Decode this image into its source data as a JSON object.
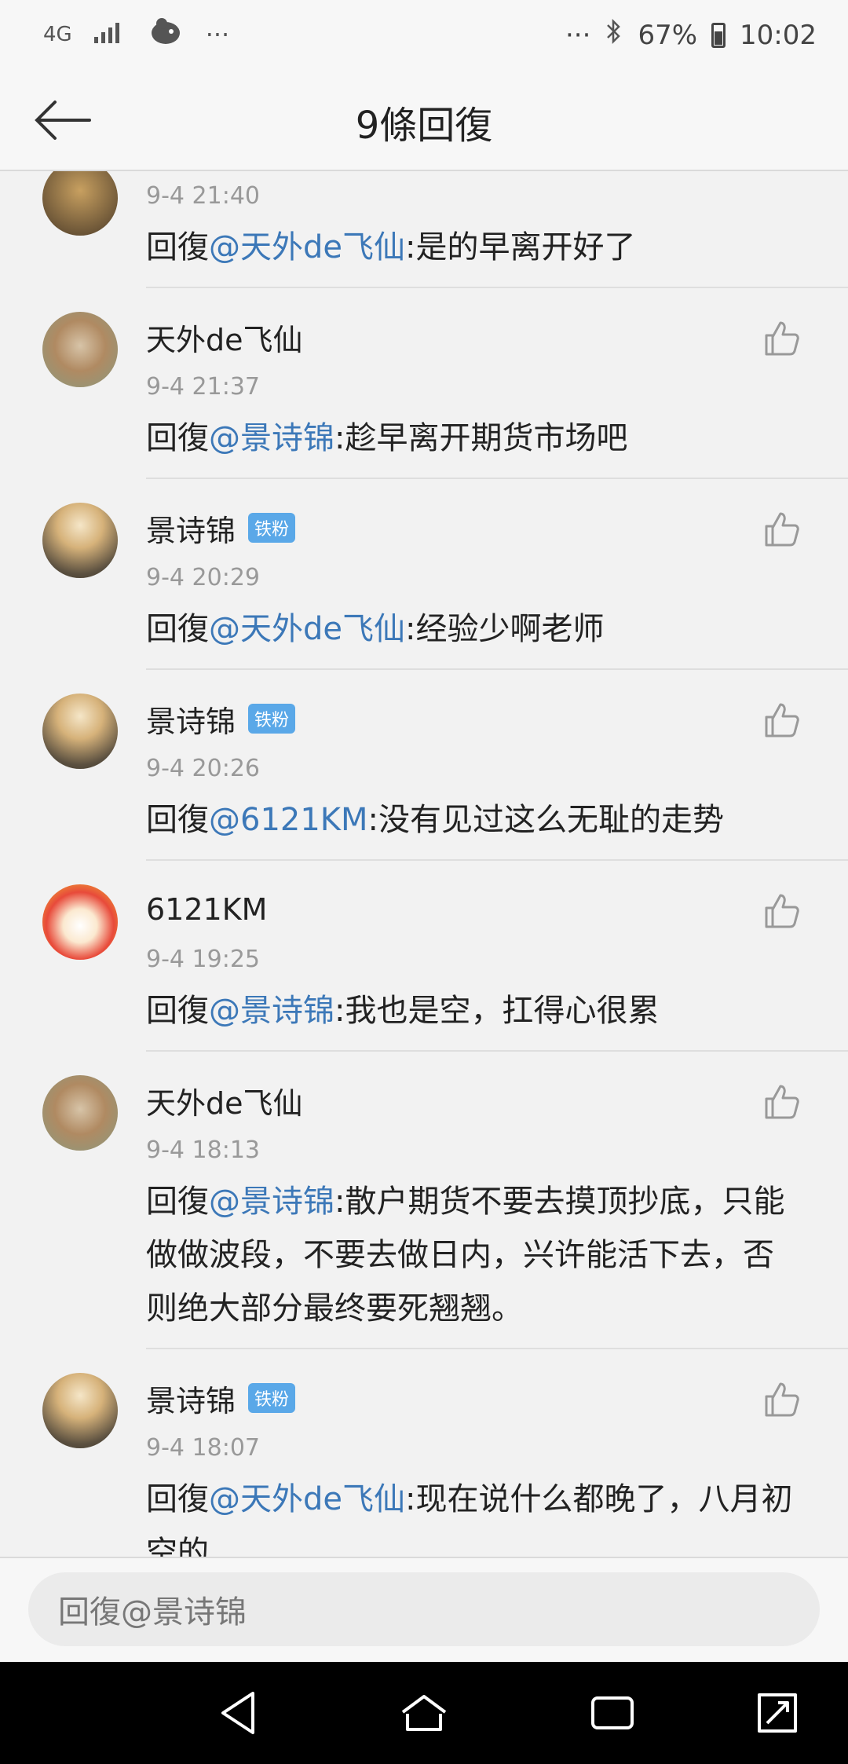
{
  "status": {
    "network": "4G",
    "battery": "67%",
    "time": "10:02",
    "dots_left": "···",
    "dots_right": "···"
  },
  "header": {
    "title": "9條回復"
  },
  "comments": [
    {
      "name": "",
      "time": "9-4 21:40",
      "prefix": "回復",
      "mention": "@天外de飞仙",
      "text": ":是的早离开好了",
      "badge": ""
    },
    {
      "name": "天外de飞仙",
      "time": "9-4 21:37",
      "prefix": "回復",
      "mention": "@景诗锦",
      "text": ":趁早离开期货市场吧",
      "badge": ""
    },
    {
      "name": "景诗锦",
      "time": "9-4 20:29",
      "prefix": "回復",
      "mention": "@天外de飞仙",
      "text": ":经验少啊老师",
      "badge": "铁粉"
    },
    {
      "name": "景诗锦",
      "time": "9-4 20:26",
      "prefix": "回復",
      "mention": "@6121KM",
      "text": ":没有见过这么无耻的走势",
      "badge": "铁粉"
    },
    {
      "name": "6121KM",
      "time": "9-4 19:25",
      "prefix": "回復",
      "mention": "@景诗锦",
      "text": ":我也是空，扛得心很累",
      "badge": ""
    },
    {
      "name": "天外de飞仙",
      "time": "9-4 18:13",
      "prefix": "回復",
      "mention": "@景诗锦",
      "text": ":散户期货不要去摸顶抄底，只能做做波段，不要去做日内，兴许能活下去，否则绝大部分最终要死翘翘。",
      "badge": ""
    },
    {
      "name": "景诗锦",
      "time": "9-4 18:07",
      "prefix": "回復",
      "mention": "@天外de飞仙",
      "text": ":现在说什么都晚了，八月初空的",
      "badge": "铁粉"
    }
  ],
  "input": {
    "placeholder": "回復@景诗锦"
  },
  "icons": {
    "back": "arrow-left-icon",
    "like": "thumbs-up-icon",
    "nav_back": "triangle-back-icon",
    "nav_home": "home-icon",
    "nav_recent": "recent-apps-icon",
    "nav_expand": "expand-icon"
  },
  "colors": {
    "mention": "#3c78b8",
    "badge": "#5aa8e8",
    "time": "#999999"
  }
}
